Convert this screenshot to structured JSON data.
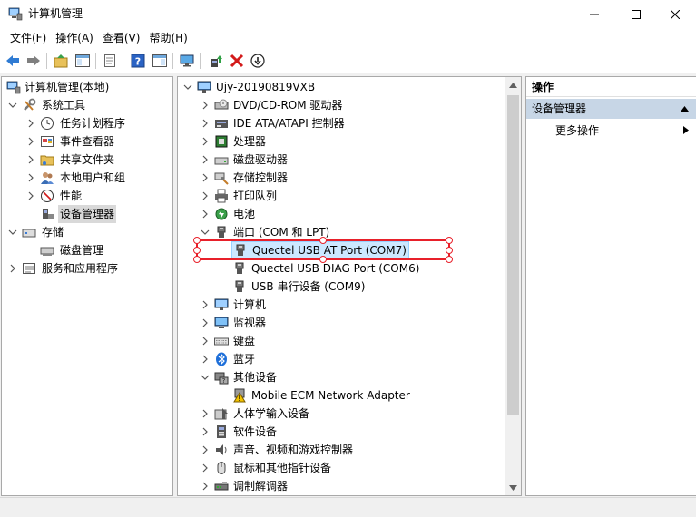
{
  "window": {
    "title": "计算机管理"
  },
  "menu": [
    "文件(F)",
    "操作(A)",
    "查看(V)",
    "帮助(H)"
  ],
  "toolbar_icons": [
    "back-icon",
    "forward-icon",
    "up-folder-icon",
    "show-hide-tree-icon",
    "properties-icon",
    "help-icon",
    "action-pane-icon",
    "monitor-icon",
    "update-driver-icon",
    "uninstall-icon",
    "disable-device-icon"
  ],
  "left_tree": {
    "root": "计算机管理(本地)",
    "system_tools": "系统工具",
    "task_scheduler": "任务计划程序",
    "event_viewer": "事件查看器",
    "shared_folders": "共享文件夹",
    "local_users": "本地用户和组",
    "performance": "性能",
    "device_manager": "设备管理器",
    "storage": "存储",
    "disk_management": "磁盘管理",
    "services": "服务和应用程序"
  },
  "device_tree": {
    "root": "Ujy-20190819VXB",
    "categories": {
      "dvd": "DVD/CD-ROM 驱动器",
      "ide": "IDE ATA/ATAPI 控制器",
      "cpu": "处理器",
      "disk": "磁盘驱动器",
      "storage_ctrl": "存储控制器",
      "print_queue": "打印队列",
      "battery": "电池",
      "ports": "端口 (COM 和 LPT)",
      "computer": "计算机",
      "monitor": "监视器",
      "keyboard": "键盘",
      "bluetooth": "蓝牙",
      "other": "其他设备",
      "hid": "人体学输入设备",
      "software": "软件设备",
      "audio": "声音、视频和游戏控制器",
      "mouse": "鼠标和其他指针设备",
      "modem": "调制解调器"
    },
    "ports_children": [
      "Quectel USB AT Port (COM7)",
      "Quectel USB DIAG Port (COM6)",
      "USB 串行设备 (COM9)"
    ],
    "other_children": [
      "Mobile ECM Network Adapter"
    ]
  },
  "actions": {
    "header": "操作",
    "section": "设备管理器",
    "more": "更多操作"
  },
  "colors": {
    "highlight_row": "#cce8ff",
    "annotation": "#e8202a",
    "action_section": "#c7d6e6"
  }
}
